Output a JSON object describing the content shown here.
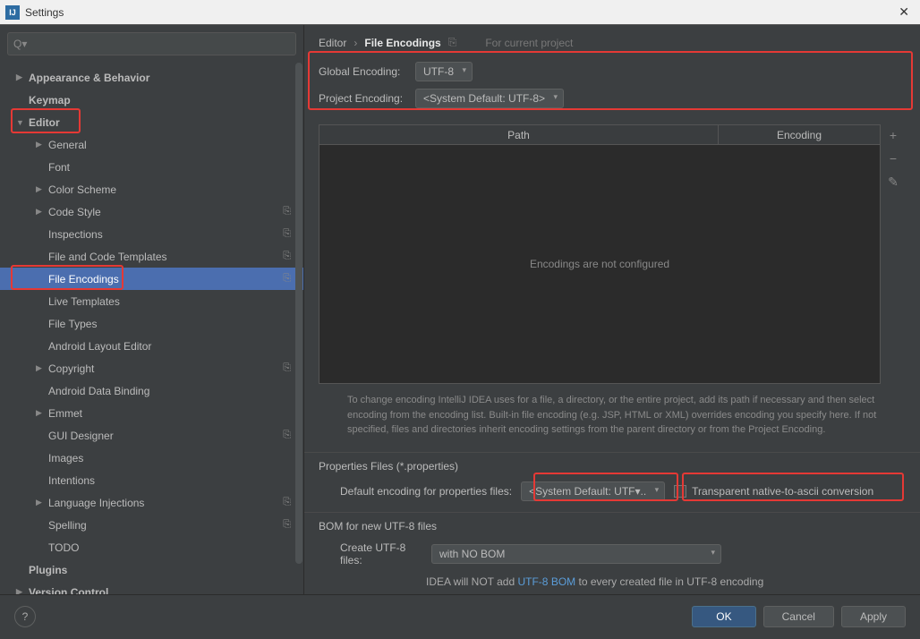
{
  "window": {
    "title": "Settings"
  },
  "search": {
    "placeholder": "Q▾"
  },
  "sidebar": {
    "items": [
      {
        "label": "Appearance & Behavior",
        "arrow": "▶",
        "bold": true,
        "indent": 0
      },
      {
        "label": "Keymap",
        "arrow": "",
        "bold": true,
        "indent": 0
      },
      {
        "label": "Editor",
        "arrow": "▼",
        "bold": true,
        "indent": 0,
        "highlight": true
      },
      {
        "label": "General",
        "arrow": "▶",
        "indent": 1
      },
      {
        "label": "Font",
        "arrow": "",
        "indent": 1
      },
      {
        "label": "Color Scheme",
        "arrow": "▶",
        "indent": 1
      },
      {
        "label": "Code Style",
        "arrow": "▶",
        "indent": 1,
        "copy": true
      },
      {
        "label": "Inspections",
        "arrow": "",
        "indent": 1,
        "copy": true
      },
      {
        "label": "File and Code Templates",
        "arrow": "",
        "indent": 1,
        "copy": true
      },
      {
        "label": "File Encodings",
        "arrow": "",
        "indent": 1,
        "copy": true,
        "selected": true,
        "highlight": true
      },
      {
        "label": "Live Templates",
        "arrow": "",
        "indent": 1
      },
      {
        "label": "File Types",
        "arrow": "",
        "indent": 1
      },
      {
        "label": "Android Layout Editor",
        "arrow": "",
        "indent": 1
      },
      {
        "label": "Copyright",
        "arrow": "▶",
        "indent": 1,
        "copy": true
      },
      {
        "label": "Android Data Binding",
        "arrow": "",
        "indent": 1
      },
      {
        "label": "Emmet",
        "arrow": "▶",
        "indent": 1
      },
      {
        "label": "GUI Designer",
        "arrow": "",
        "indent": 1,
        "copy": true
      },
      {
        "label": "Images",
        "arrow": "",
        "indent": 1
      },
      {
        "label": "Intentions",
        "arrow": "",
        "indent": 1
      },
      {
        "label": "Language Injections",
        "arrow": "▶",
        "indent": 1,
        "copy": true
      },
      {
        "label": "Spelling",
        "arrow": "",
        "indent": 1,
        "copy": true
      },
      {
        "label": "TODO",
        "arrow": "",
        "indent": 1
      },
      {
        "label": "Plugins",
        "arrow": "",
        "bold": true,
        "indent": 0
      },
      {
        "label": "Version Control",
        "arrow": "▶",
        "bold": true,
        "indent": 0
      }
    ]
  },
  "breadcrumb": {
    "a": "Editor",
    "b": "File Encodings",
    "project": "For current project"
  },
  "encoding": {
    "global_label": "Global Encoding:",
    "global_value": "UTF-8",
    "project_label": "Project Encoding:",
    "project_value": "<System Default: UTF-8>"
  },
  "table": {
    "col_path": "Path",
    "col_enc": "Encoding",
    "empty": "Encodings are not configured"
  },
  "help_text": "To change encoding IntelliJ IDEA uses for a file, a directory, or the entire project, add its path if necessary and then select encoding from the encoding list. Built-in file encoding (e.g. JSP, HTML or XML) overrides encoding you specify here. If not specified, files and directories inherit encoding settings from the parent directory or from the Project Encoding.",
  "properties": {
    "title": "Properties Files (*.properties)",
    "label": "Default encoding for properties files:",
    "value": "<System Default: UTF▾..",
    "checkbox_label": "Transparent native-to-ascii conversion"
  },
  "bom": {
    "title": "BOM for new UTF-8 files",
    "label": "Create UTF-8 files:",
    "value": "with NO BOM",
    "note_prefix": "IDEA will NOT add ",
    "note_link": "UTF-8 BOM",
    "note_suffix": " to every created file in UTF-8 encoding"
  },
  "buttons": {
    "ok": "OK",
    "cancel": "Cancel",
    "apply": "Apply",
    "help": "?"
  }
}
